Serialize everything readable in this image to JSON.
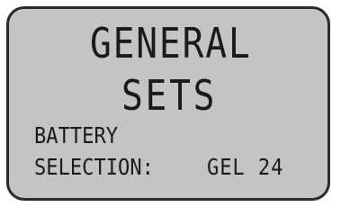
{
  "display": {
    "title_line1": "GENERAL",
    "title_line2": "SETS",
    "setting_label_line1": "BATTERY",
    "setting_label_line2": "SELECTION:",
    "setting_value": "GEL 24"
  }
}
